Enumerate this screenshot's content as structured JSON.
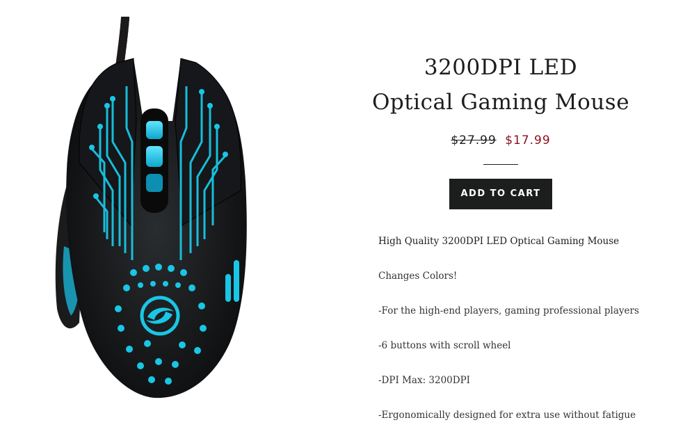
{
  "product": {
    "title_line1": "3200DPI LED",
    "title_line2": "Optical Gaming Mouse",
    "price_original": "$27.99",
    "price_sale": "$17.99",
    "add_to_cart_label": "ADD TO CART",
    "image_alt": "Black gaming mouse with blue LED circuit pattern"
  },
  "description": {
    "lines": [
      "High Quality 3200DPI LED Optical Gaming Mouse",
      "Changes Colors!",
      "-For the high-end players, gaming professional players",
      "-6 buttons with scroll wheel",
      "-DPI Max: 3200DPI",
      "-Ergonomically designed for extra use without fatigue"
    ]
  },
  "colors": {
    "text": "#1c1d1d",
    "sale_price": "#8b0f1b",
    "button_bg": "#1c1d1d",
    "button_text": "#ffffff",
    "led_glow": "#19c6e6",
    "cable_red": "#b3121c"
  }
}
